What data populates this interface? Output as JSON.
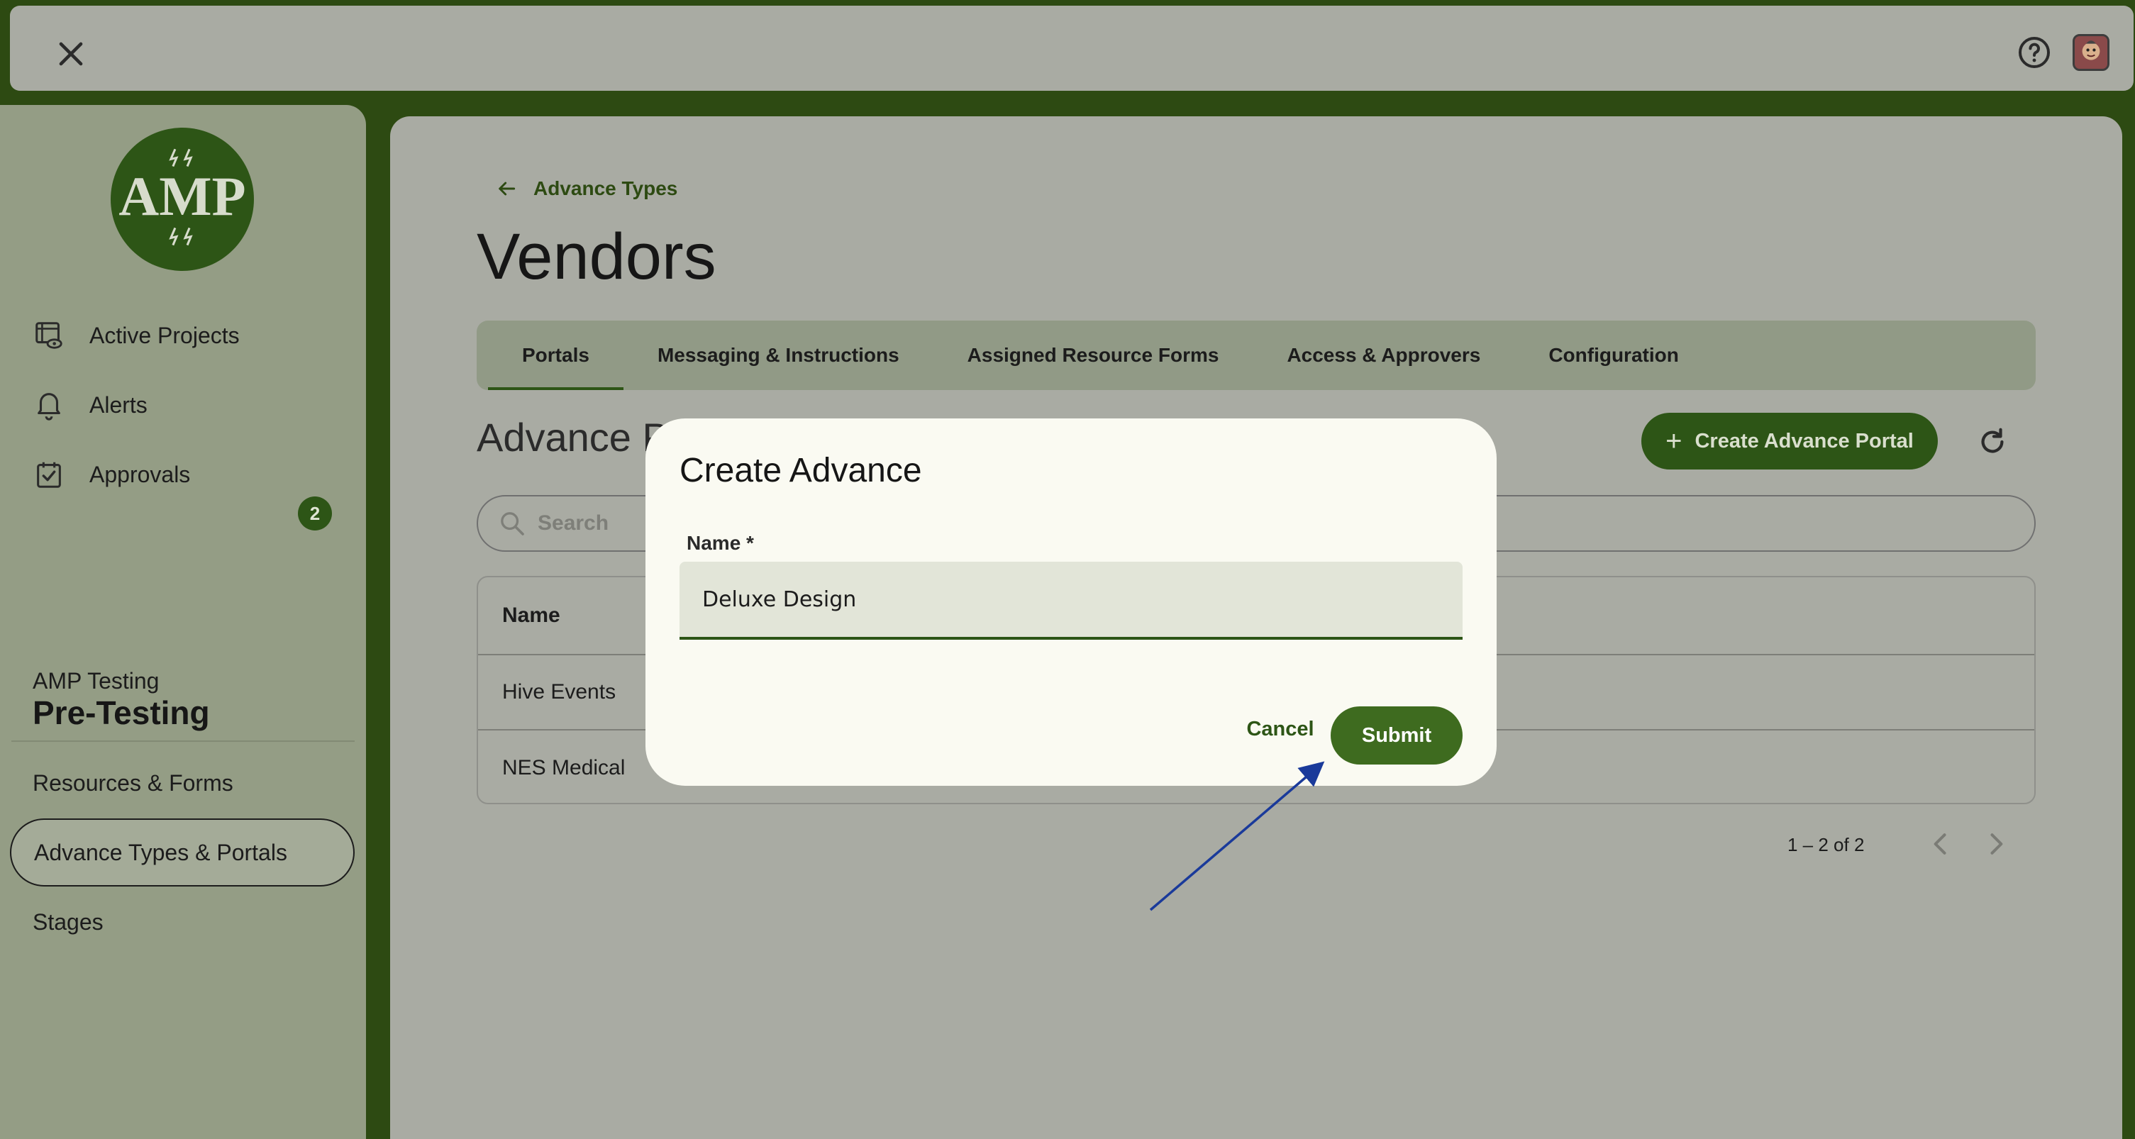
{
  "topbar": {
    "close_icon": "close-icon",
    "help_icon": "help-icon",
    "avatar_icon": "avatar"
  },
  "sidebar": {
    "logo_text": "AMP",
    "nav": [
      {
        "label": "Active Projects",
        "icon": "projects-eye-icon"
      },
      {
        "label": "Alerts",
        "icon": "bell-icon",
        "badge": "2"
      },
      {
        "label": "Approvals",
        "icon": "calendar-check-icon"
      }
    ],
    "project_org": "AMP Testing",
    "project_name": "Pre-Testing",
    "sub_nav": [
      {
        "label": "Resources & Forms"
      },
      {
        "label": "Advance Types & Portals",
        "active": true
      },
      {
        "label": "Stages"
      }
    ]
  },
  "main": {
    "back_label": "Advance Types",
    "title": "Vendors",
    "tabs": [
      {
        "label": "Portals",
        "active": true
      },
      {
        "label": "Messaging & Instructions"
      },
      {
        "label": "Assigned Resource Forms"
      },
      {
        "label": "Access & Approvers"
      },
      {
        "label": "Configuration"
      }
    ],
    "section_title": "Advance Portals",
    "create_button": "Create Advance Portal",
    "search_placeholder": "Search",
    "table": {
      "header": "Name",
      "rows": [
        "Hive Events",
        "NES Medical"
      ]
    },
    "pager": "1 – 2 of 2"
  },
  "dialog": {
    "title": "Create Advance",
    "field_label": "Name *",
    "field_value": "Deluxe Design",
    "cancel_label": "Cancel",
    "submit_label": "Submit"
  },
  "colors": {
    "brand_dark": "#2d4a12",
    "brand_button": "#2d5516",
    "submit": "#3e6b1f",
    "annotation_arrow": "#1a3a9a"
  }
}
